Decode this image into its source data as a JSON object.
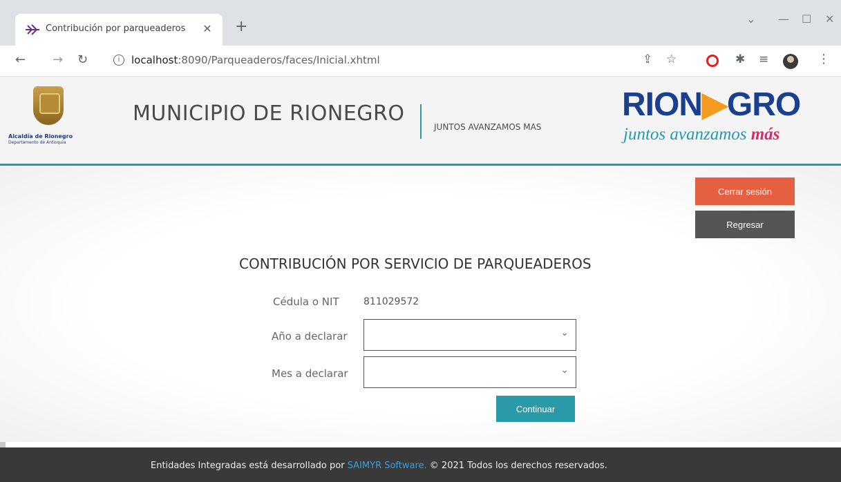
{
  "browser": {
    "tab_title": "Contribución por parqueaderos",
    "tab_close": "✕",
    "new_tab": "+",
    "url_host": "localhost",
    "url_path": ":8090/Parqueaderos/faces/Inicial.xhtml"
  },
  "header": {
    "seal_text": "Alcaldía de Rionegro",
    "seal_subtext": "Departamento de Antioquia",
    "title": "MUNICIPIO DE RIONEGRO",
    "tagline": "JUNTOS AVANZAMOS MAS",
    "brand_part1": "RION",
    "brand_part2": "GRO",
    "brand_arrow": "▶",
    "brand_slogan_main": "juntos avanzamos ",
    "brand_slogan_highlight": "más"
  },
  "actions": {
    "logout_label": "Cerrar sesión",
    "back_label": "Regresar"
  },
  "form": {
    "title": "CONTRIBUCIÓN POR SERVICIO DE PARQUEADEROS",
    "id_label": "Cédula o NIT",
    "id_value": "811029572",
    "year_label": "Año a declarar",
    "year_value": "",
    "month_label": "Mes a declarar",
    "month_value": "",
    "submit_label": "Continuar"
  },
  "footer": {
    "text_before": "Entidades Integradas está desarrollado por ",
    "link_text": "SAIMYR Software.",
    "text_after": " © 2021 Todos los derechos reservados."
  },
  "colors": {
    "accent": "#2a9aa8",
    "logout": "#e56040",
    "back": "#555555",
    "footer_bg": "#393939",
    "brand_blue": "#1a3f8c"
  }
}
